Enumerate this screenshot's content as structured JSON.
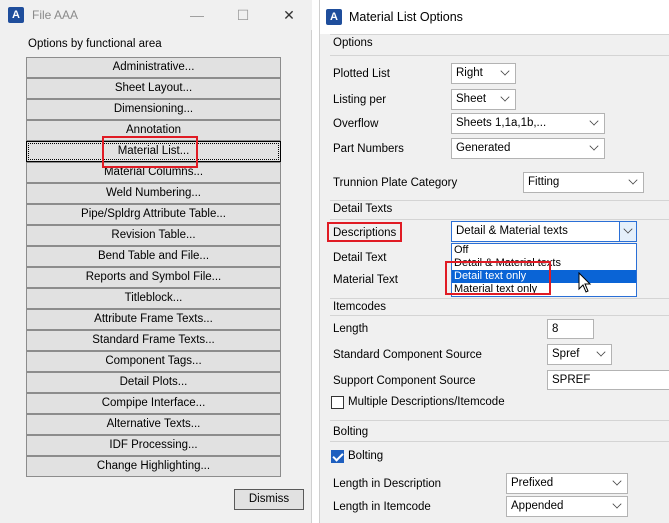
{
  "left_window": {
    "title": "File AAA",
    "controls": {
      "minimize": "—",
      "maximize": "☐",
      "close": "✕"
    },
    "group_label": "Options by functional area",
    "buttons": [
      "Administrative...",
      "Sheet Layout...",
      "Dimensioning...",
      "Annotation",
      "Material List...",
      "Material Columns...",
      "Weld Numbering...",
      "Pipe/Spldrg Attribute Table...",
      "Revision Table...",
      "Bend Table and File...",
      "Reports and Symbol File...",
      "Titleblock...",
      "Attribute Frame Texts...",
      "Standard Frame Texts...",
      "Component Tags...",
      "Detail Plots...",
      "Compipe Interface...",
      "Alternative Texts...",
      "IDF Processing...",
      "Change Highlighting..."
    ],
    "dismiss_label": "Dismiss"
  },
  "right_window": {
    "title": "Material List Options",
    "options": {
      "section": "Options",
      "plotted_list_label": "Plotted List",
      "plotted_list_value": "Right",
      "listing_per_label": "Listing per",
      "listing_per_value": "Sheet",
      "overflow_label": "Overflow",
      "overflow_value": "Sheets 1,1a,1b,...",
      "part_numbers_label": "Part Numbers",
      "part_numbers_value": "Generated",
      "trunnion_label": "Trunnion Plate Category",
      "trunnion_value": "Fitting"
    },
    "detail_texts": {
      "section": "Detail Texts",
      "descriptions_label": "Descriptions",
      "descriptions_value": "Detail & Material texts",
      "detail_text_label": "Detail Text",
      "material_text_label": "Material Text",
      "dropdown_options": [
        "Off",
        "Detail & Material texts",
        "Detail text only",
        "Material text only"
      ],
      "dropdown_selected_index": 2
    },
    "itemcodes": {
      "section": "Itemcodes",
      "length_label": "Length",
      "length_value": "8",
      "std_source_label": "Standard Component Source",
      "std_source_value": "Spref",
      "support_source_label": "Support Component Source",
      "support_source_value": "SPREF",
      "multiple_label": "Multiple Descriptions/Itemcode",
      "multiple_checked": false
    },
    "bolting": {
      "section": "Bolting",
      "bolting_label": "Bolting",
      "bolting_checked": true,
      "length_desc_label": "Length in Description",
      "length_desc_value": "Prefixed",
      "length_item_label": "Length in Itemcode",
      "length_item_value": "Appended"
    }
  },
  "colors": {
    "highlight": "#e01b24",
    "selection": "#0a64d6",
    "app_icon": "#1f4e9c"
  }
}
